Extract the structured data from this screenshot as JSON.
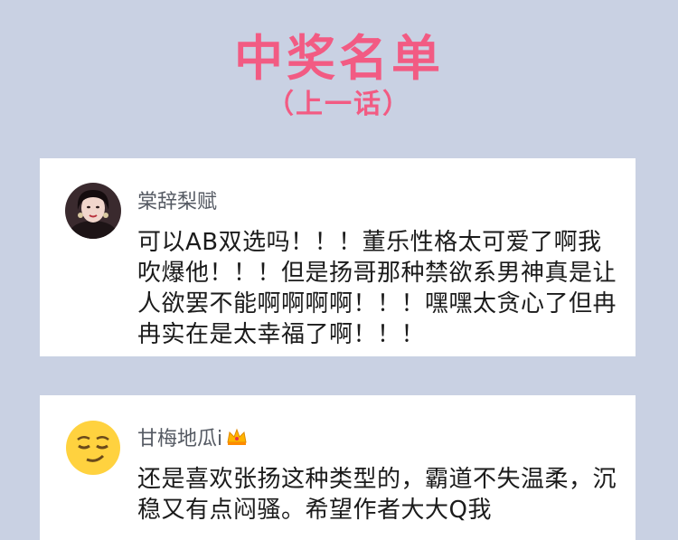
{
  "header": {
    "title": "中奖名单",
    "subtitle": "（上一话）"
  },
  "comments": [
    {
      "username": "棠辞梨赋",
      "text": "可以AB双选吗！！！董乐性格太可爱了啊我吹爆他！！！但是扬哥那种禁欲系男神真是让人欲罢不能啊啊啊啊！！！嘿嘿太贪心了但冉冉实在是太幸福了啊！！！",
      "avatar": "portrait-avatar"
    },
    {
      "username": "甘梅地瓜i",
      "badge_icon": "crown-icon",
      "text": "还是喜欢张扬这种类型的，霸道不失温柔，沉稳又有点闷骚。希望作者大大Q我",
      "avatar": "smirk-emoji-avatar"
    }
  ],
  "colors": {
    "background": "#c9d1e3",
    "accent": "#f25b83",
    "card": "#ffffff"
  }
}
